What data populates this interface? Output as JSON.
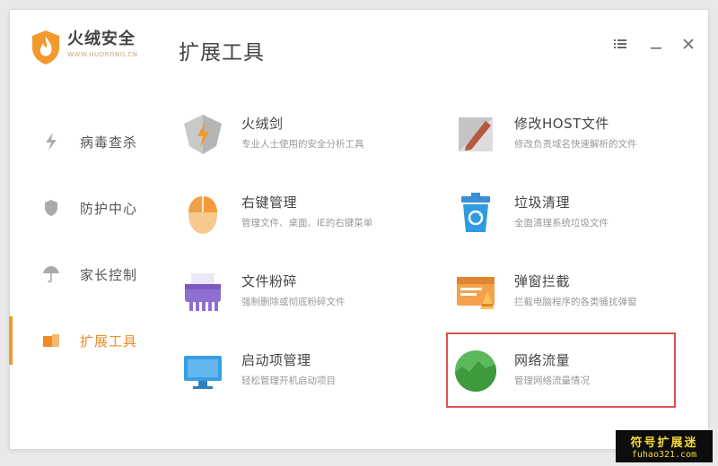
{
  "app": {
    "brand_name": "火绒安全",
    "brand_url": "WWW.HUORONG.CN"
  },
  "page": {
    "title": "扩展工具"
  },
  "window_controls": [
    "menu-icon",
    "minimize-icon",
    "close-icon"
  ],
  "sidebar": {
    "items": [
      {
        "label": "病毒查杀",
        "icon": "lightning-icon",
        "active": false
      },
      {
        "label": "防护中心",
        "icon": "shield-icon",
        "active": false
      },
      {
        "label": "家长控制",
        "icon": "umbrella-icon",
        "active": false
      },
      {
        "label": "扩展工具",
        "icon": "tools-icon",
        "active": true
      }
    ]
  },
  "tools": [
    {
      "name": "火绒剑",
      "desc": "专业人士使用的安全分析工具",
      "icon": "sword-icon"
    },
    {
      "name": "修改HOST文件",
      "desc": "修改负责域名快速解析的文件",
      "icon": "edit-host-icon"
    },
    {
      "name": "右键管理",
      "desc": "管理文件、桌面、IE的右键菜单",
      "icon": "mouse-icon"
    },
    {
      "name": "垃圾清理",
      "desc": "全面清理系统垃圾文件",
      "icon": "trash-icon"
    },
    {
      "name": "文件粉碎",
      "desc": "强制删除或彻底粉碎文件",
      "icon": "shredder-icon"
    },
    {
      "name": "弹窗拦截",
      "desc": "拦截电脑程序的各类骚扰弹窗",
      "icon": "popup-block-icon"
    },
    {
      "name": "启动项管理",
      "desc": "轻松管理开机启动项目",
      "icon": "monitor-icon"
    },
    {
      "name": "网络流量",
      "desc": "管理网络流量情况",
      "icon": "traffic-icon",
      "highlighted": true
    }
  ],
  "watermark": {
    "title": "符号扩展迷",
    "url": "fuhao321.com"
  },
  "colors": {
    "accent": "#f2992e",
    "highlight": "#d9534f"
  }
}
